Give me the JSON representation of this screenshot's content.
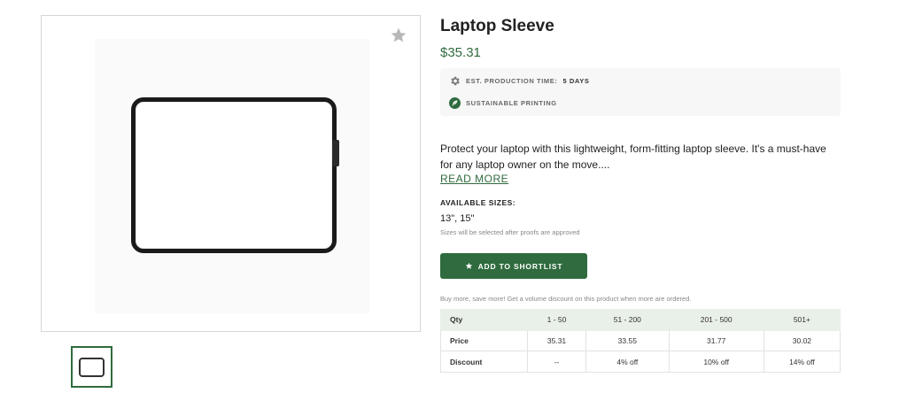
{
  "product": {
    "title": "Laptop Sleeve",
    "price": "$35.31",
    "description": "Protect your laptop with this lightweight, form-fitting laptop sleeve. It's a must-have for any laptop owner on the move....",
    "read_more_label": "READ MORE"
  },
  "info": {
    "production_label": "EST. PRODUCTION TIME:",
    "production_value": "5 DAYS",
    "production_icon": "gear-icon",
    "sustainable_label": "SUSTAINABLE PRINTING",
    "sustainable_icon": "leaf-icon"
  },
  "sizes": {
    "label": "AVAILABLE SIZES:",
    "value": "13\", 15\"",
    "note": "Sizes will be selected after proofs are approved"
  },
  "shortlist": {
    "label": "ADD TO SHORTLIST",
    "icon": "star-icon"
  },
  "volume": {
    "note": "Buy more, save more! Get a volume discount on this product when more are ordered.",
    "header": [
      "Qty",
      "1 - 50",
      "51 - 200",
      "201 - 500",
      "501+"
    ],
    "price_row": [
      "Price",
      "35.31",
      "33.55",
      "31.77",
      "30.02"
    ],
    "discount_row": [
      "Discount",
      "--",
      "4% off",
      "10% off",
      "14% off"
    ]
  },
  "colors": {
    "accent": "#2f6b3e",
    "table_header_bg": "#e9efe9",
    "info_box_bg": "#f7f7f7"
  }
}
